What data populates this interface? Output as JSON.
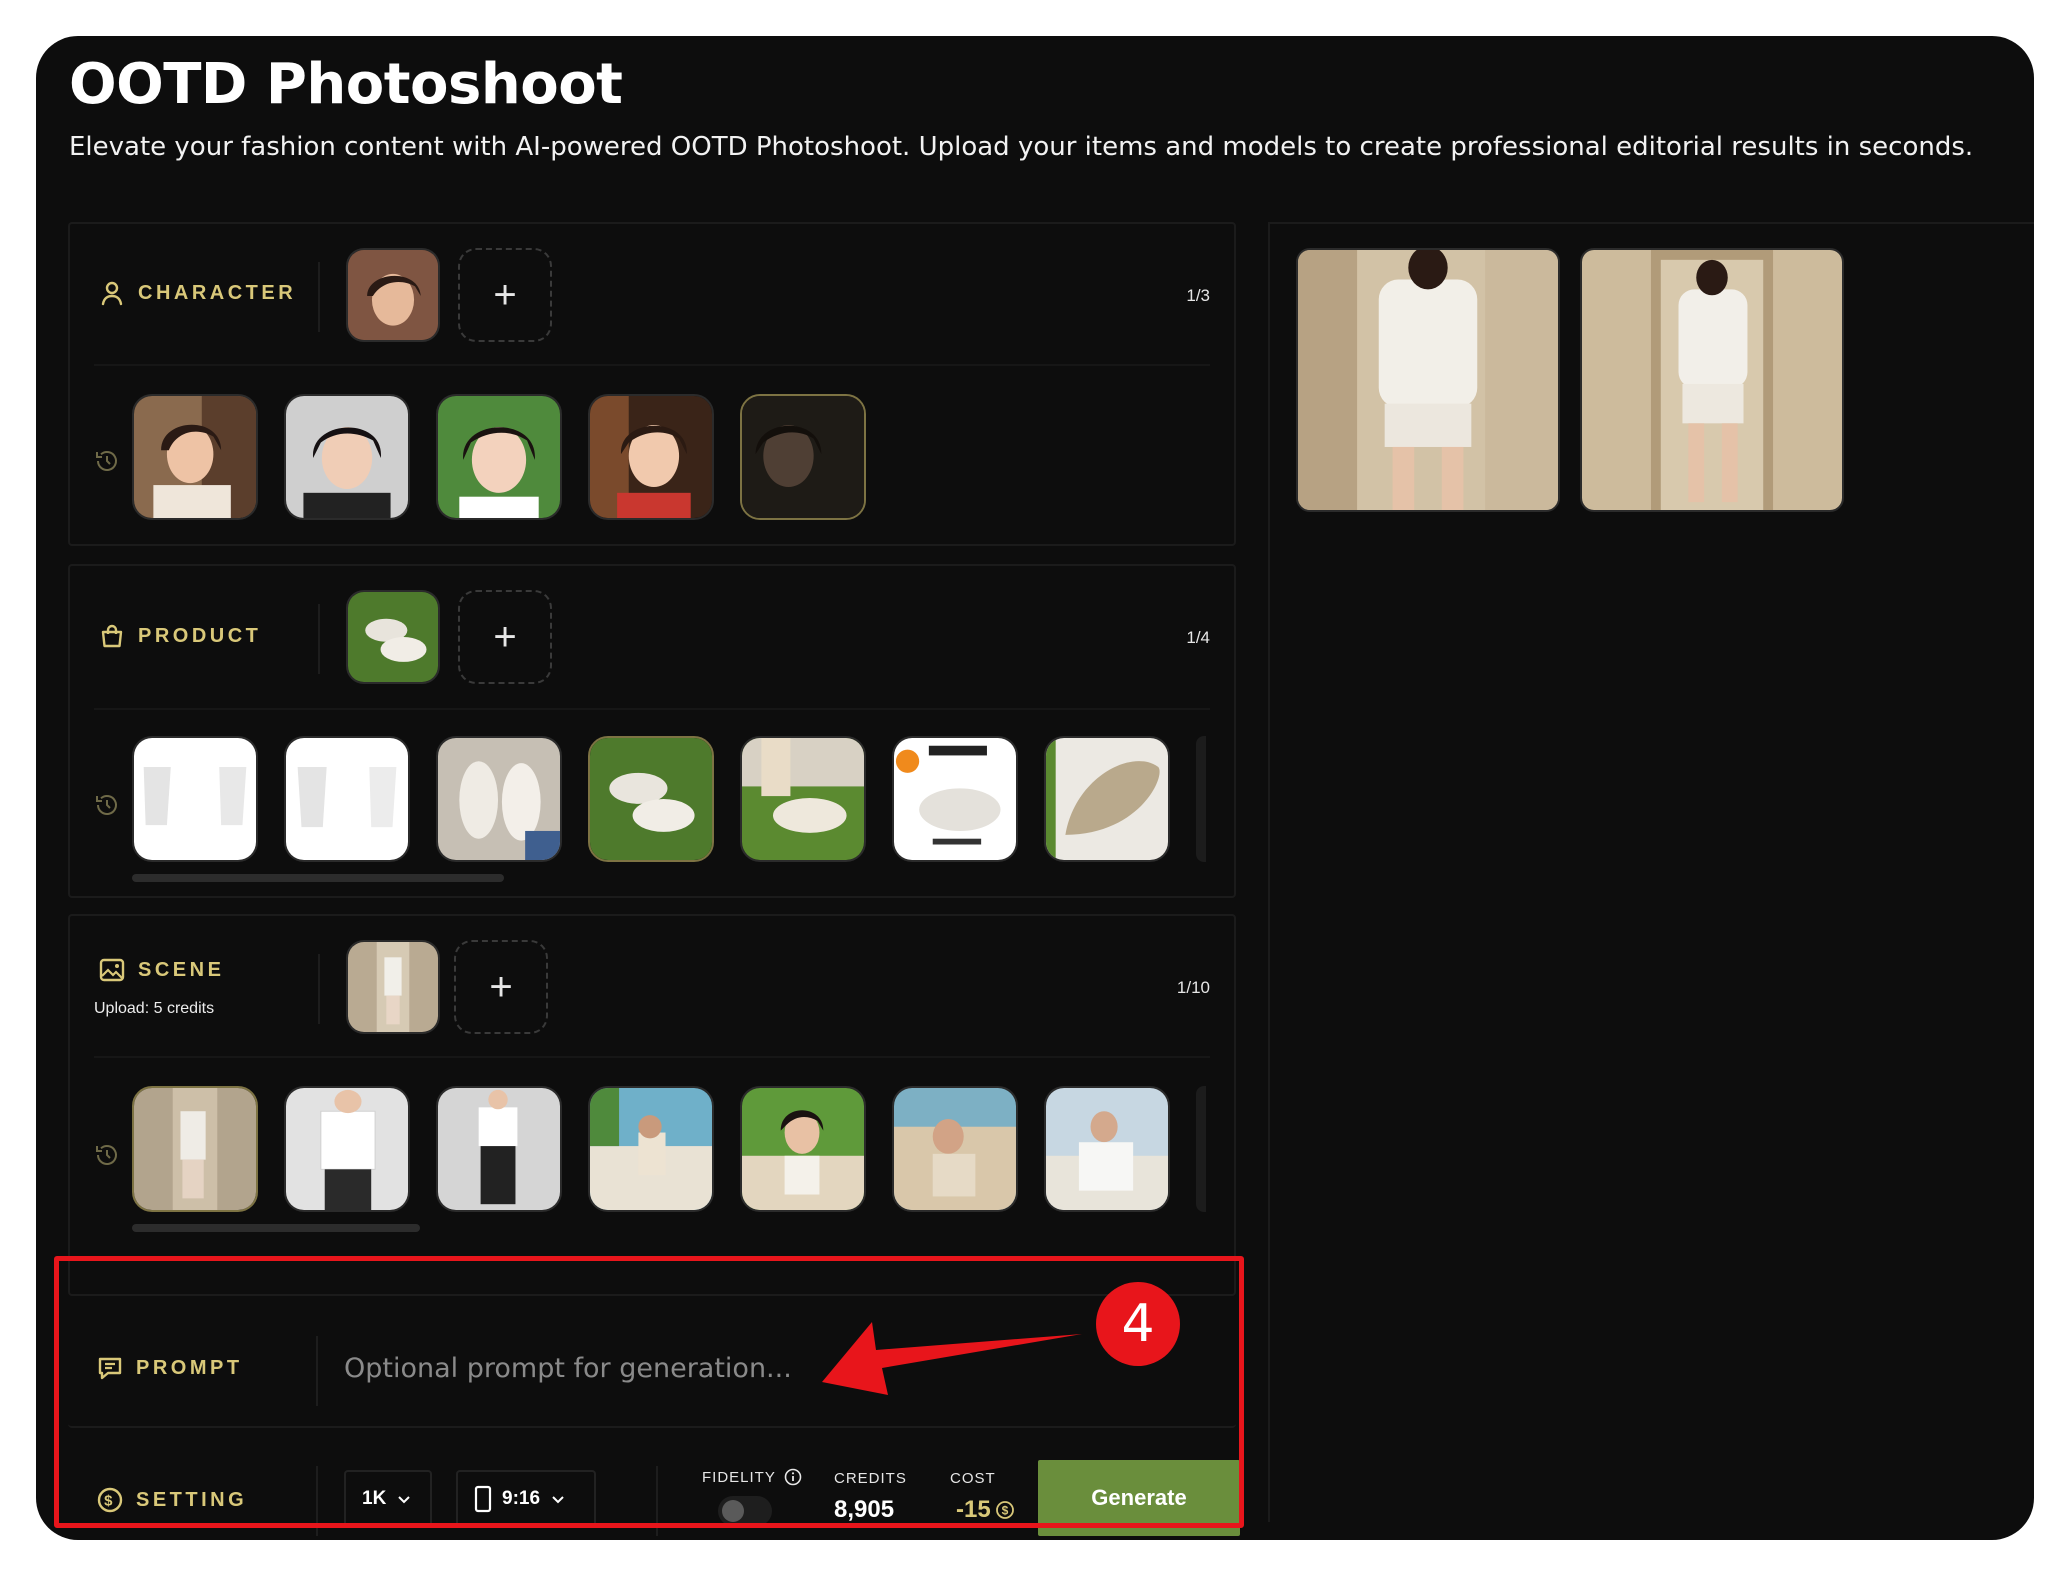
{
  "page": {
    "title": "OOTD Photoshoot",
    "subtitle": "Elevate your fashion content with AI-powered OOTD Photoshoot. Upload your items and models to create professional editorial results in seconds."
  },
  "character": {
    "label": "CHARACTER",
    "counter": "1/3",
    "add": "+"
  },
  "product": {
    "label": "PRODUCT",
    "counter": "1/4",
    "add": "+"
  },
  "scene": {
    "label": "SCENE",
    "note": "Upload: 5 credits",
    "counter": "1/10",
    "add": "+"
  },
  "prompt": {
    "label": "PROMPT",
    "placeholder": "Optional prompt for generation..."
  },
  "setting": {
    "label": "SETTING",
    "resolution": "1K",
    "aspect_ratio": "9:16",
    "fidelity_label": "FIDELITY",
    "fidelity_on": false,
    "credits_label": "CREDITS",
    "credits_value": "8,905",
    "cost_label": "COST",
    "cost_value": "-15",
    "generate_label": "Generate"
  },
  "annotation": {
    "step": "4"
  },
  "colors": {
    "accent_gold": "#d9c879",
    "generate_green": "#6a8e3c",
    "annotation_red": "#e8151b",
    "background": "#0d0d0d"
  }
}
